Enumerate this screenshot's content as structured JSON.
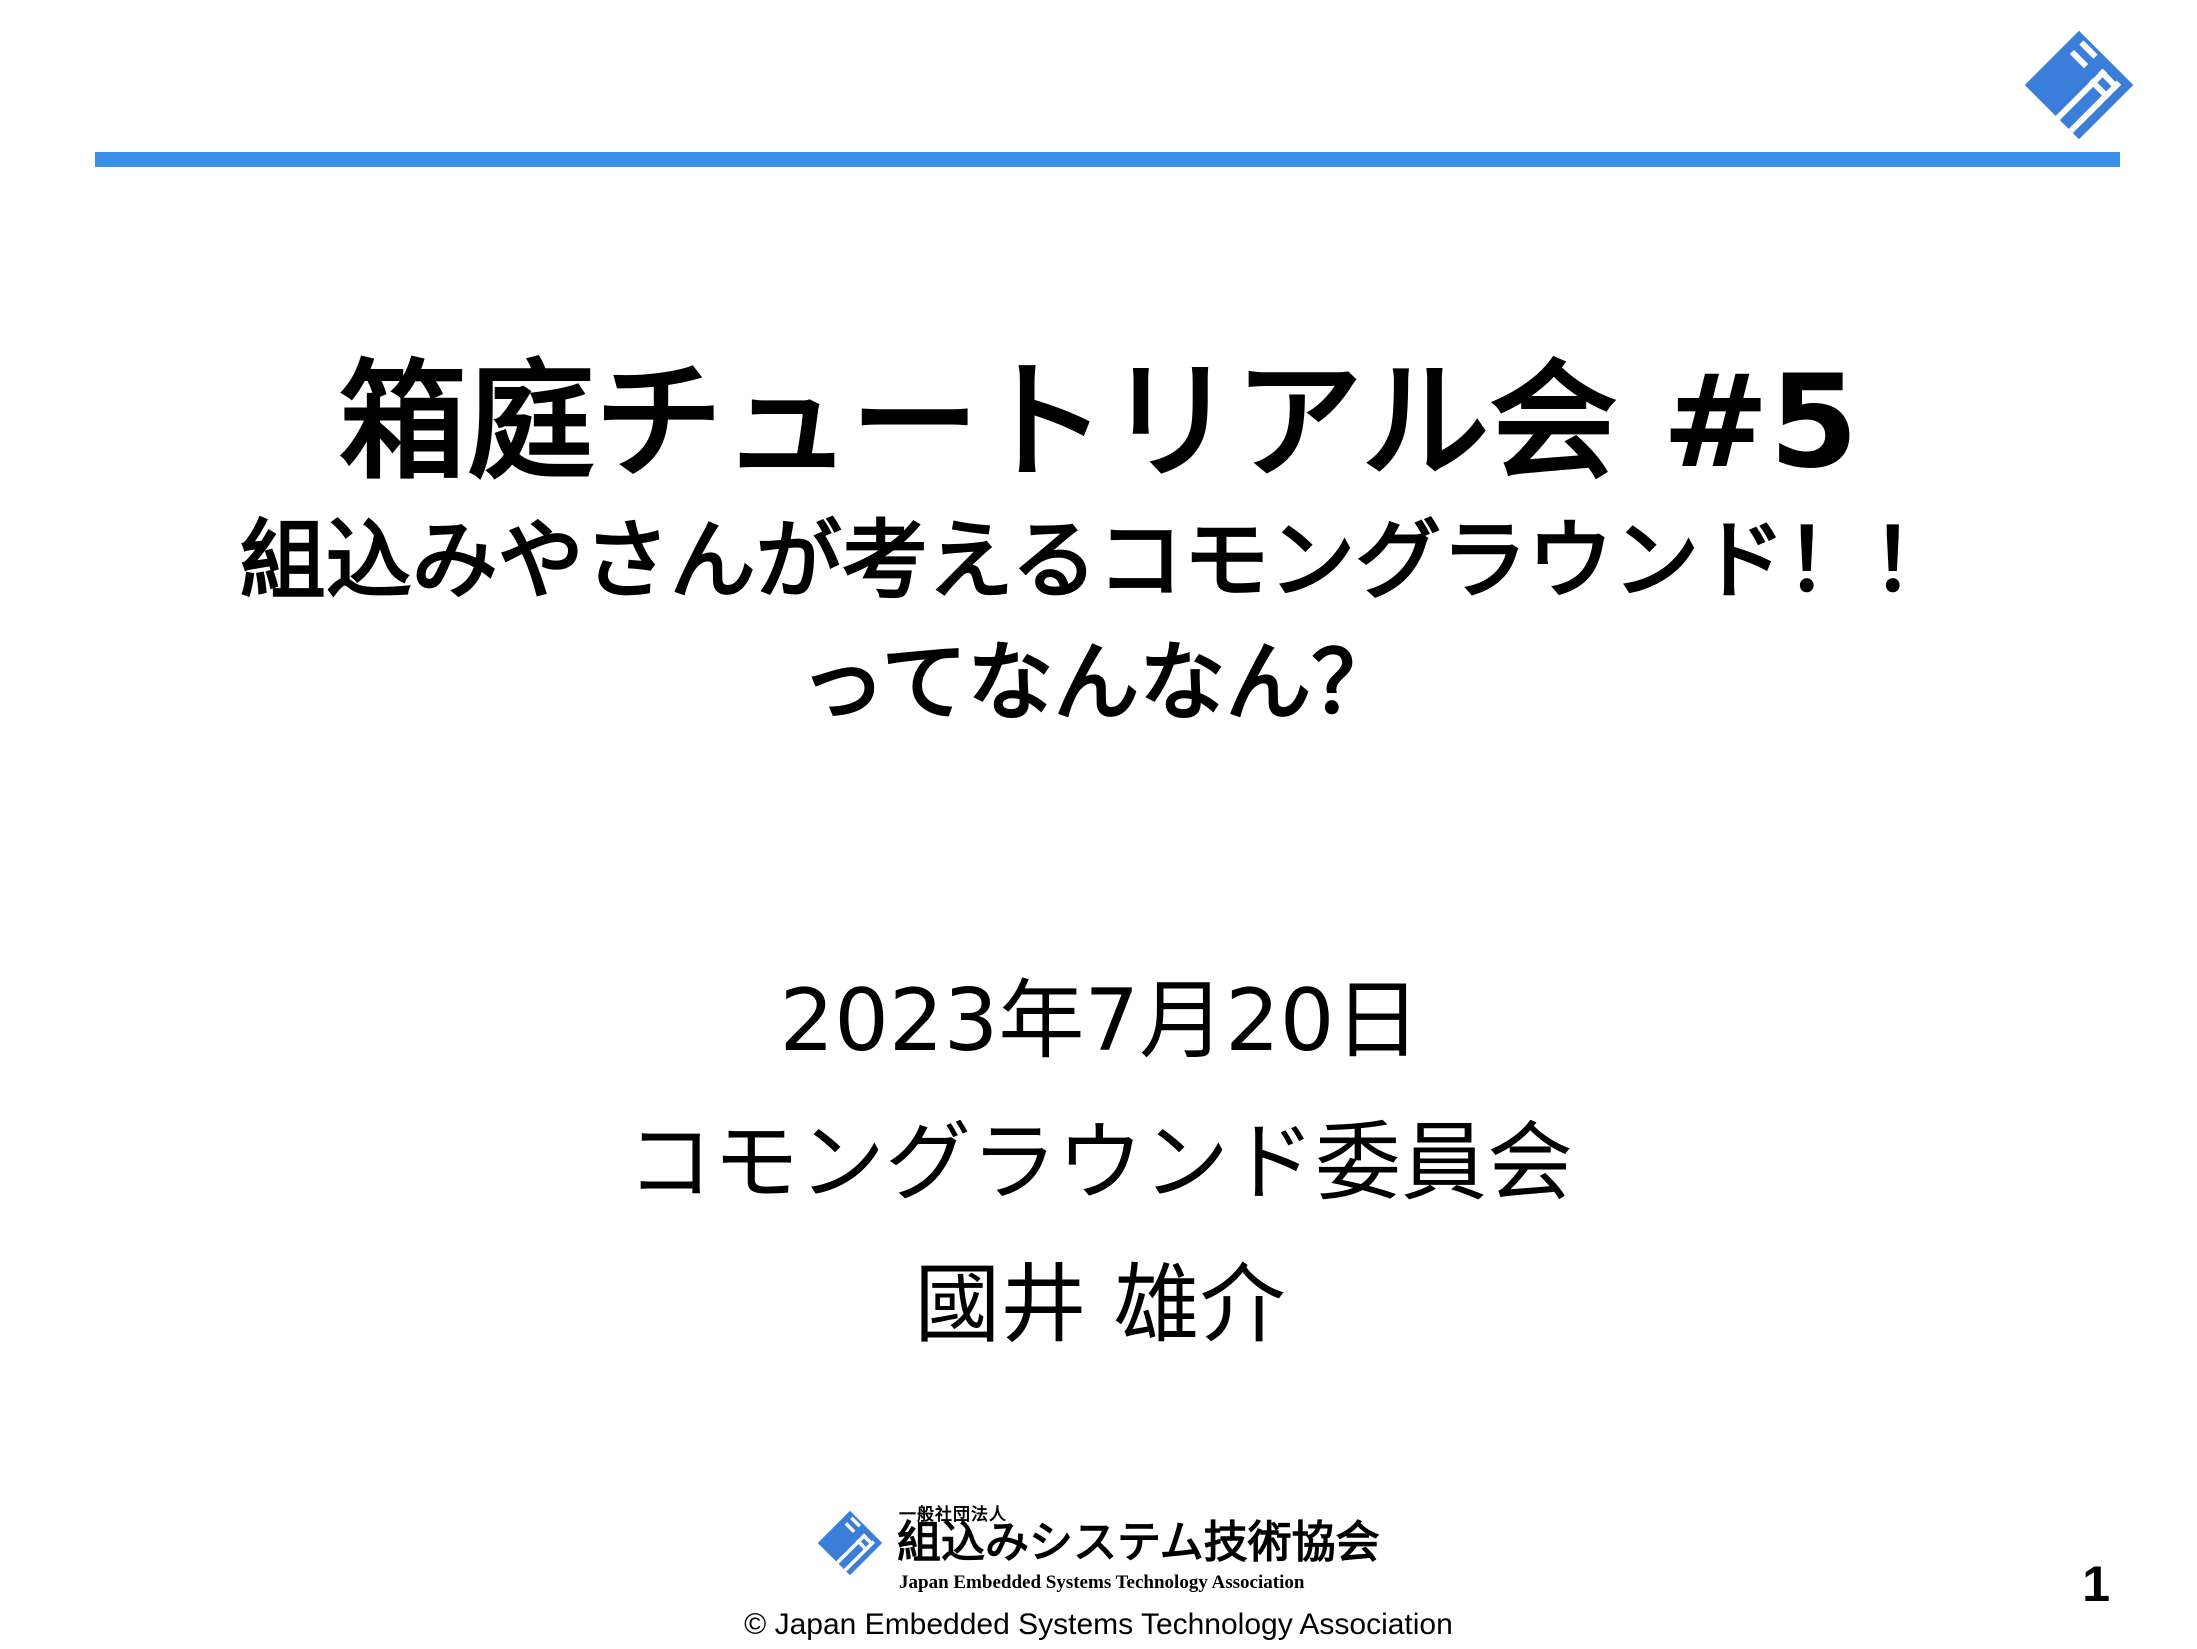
{
  "slide": {
    "title": "箱庭チュートリアル会 #5",
    "subtitle_line1": "組込みやさんが考えるコモングラウンド！！",
    "subtitle_line2": "ってなんなん？",
    "date": "2023年7月20日",
    "committee": "コモングラウンド委員会",
    "presenter": "國井 雄介",
    "org_type": "一般社団法人",
    "org_name": "組込みシステム技術協会",
    "org_name_en": "Japan Embedded Systems Technology Association",
    "copyright": "© Japan Embedded Systems Technology Association",
    "page_number": "1"
  },
  "colors": {
    "accent": "#3a8fe6",
    "logo_blue": "#3a7ed9"
  },
  "icons": {
    "corner_logo": "jasa-logo-icon",
    "footer_logo": "jasa-logo-icon"
  }
}
